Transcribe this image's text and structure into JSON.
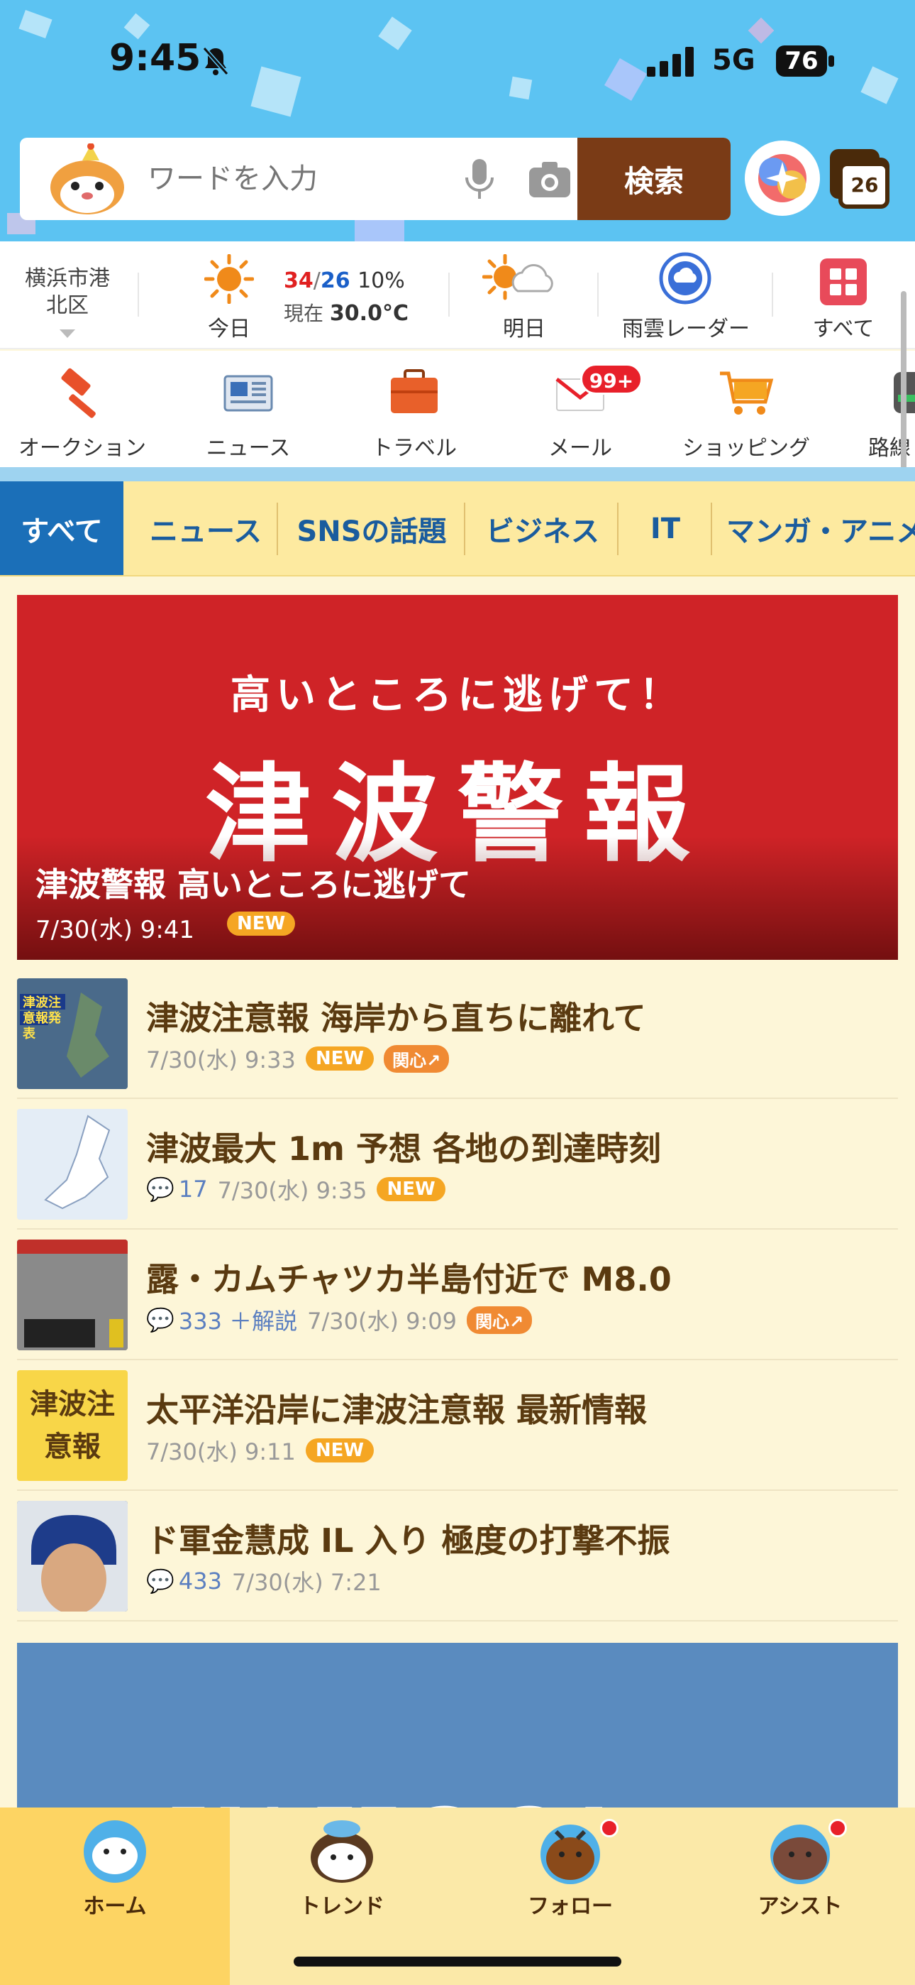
{
  "status_bar": {
    "time": "9:45",
    "network": "5G",
    "battery": "76"
  },
  "search": {
    "placeholder": "ワードを入力",
    "button_label": "検索"
  },
  "header": {
    "calendar_day": "26"
  },
  "weather": {
    "location_line1": "横浜市港",
    "location_line2": "北区",
    "today_label": "今日",
    "high": "34",
    "low": "26",
    "rain_chance": "10%",
    "current_label": "現在",
    "current_temp": "30.0°C",
    "tomorrow_label": "明日",
    "radar_label": "雨雲レーダー",
    "all_label": "すべて"
  },
  "services": {
    "items": [
      {
        "label": "オークション",
        "icon": "gavel-icon"
      },
      {
        "label": "ニュース",
        "icon": "newspaper-icon"
      },
      {
        "label": "トラベル",
        "icon": "suitcase-icon"
      },
      {
        "label": "メール",
        "icon": "mail-icon"
      },
      {
        "label": "ショッピング",
        "icon": "cart-icon"
      },
      {
        "label": "路線",
        "icon": "train-icon"
      }
    ],
    "mail_badge": "99+"
  },
  "tabs": [
    "すべて",
    "ニュース",
    "SNSの話題",
    "ビジネス",
    "IT",
    "マンガ・アニメ"
  ],
  "hero": {
    "banner_sub": "高いところに逃げて！",
    "banner_main": "津波警報",
    "title": "津波警報 高いところに逃げて",
    "date": "7/30(水) 9:41",
    "badge": "NEW"
  },
  "news": [
    {
      "title": "津波注意報 海岸から直ちに離れて",
      "date": "7/30(水) 9:33",
      "comments": "",
      "badges": [
        "NEW",
        "関心"
      ],
      "thumb_text": "津波注意報発表"
    },
    {
      "title": "津波最大 1m 予想 各地の到達時刻",
      "date": "7/30(水) 9:35",
      "comments": "17",
      "badges": [
        "NEW"
      ],
      "thumb_text": ""
    },
    {
      "title": "露・カムチャツカ半島付近で M8.0",
      "date": "7/30(水) 9:09",
      "comments": "333 ＋解説",
      "badges": [
        "関心"
      ],
      "thumb_text": ""
    },
    {
      "title": "太平洋沿岸に津波注意報 最新情報",
      "date": "7/30(水) 9:11",
      "comments": "",
      "badges": [
        "NEW"
      ],
      "thumb_text": "津波注意報"
    },
    {
      "title": "ド軍金慧成 IL 入り 極度の打撃不振",
      "date": "7/30(水) 7:21",
      "comments": "433",
      "badges": [],
      "thumb_text": ""
    }
  ],
  "banner": {
    "text": "YAHOO!ニュース"
  },
  "bottom_nav": [
    "ホーム",
    "トレンド",
    "フォロー",
    "アシスト"
  ],
  "colors": {
    "search_button": "#7a3b16",
    "tab_active": "#1b6fb8",
    "hero_red": "#cf2327",
    "new_badge": "#f5a623"
  }
}
